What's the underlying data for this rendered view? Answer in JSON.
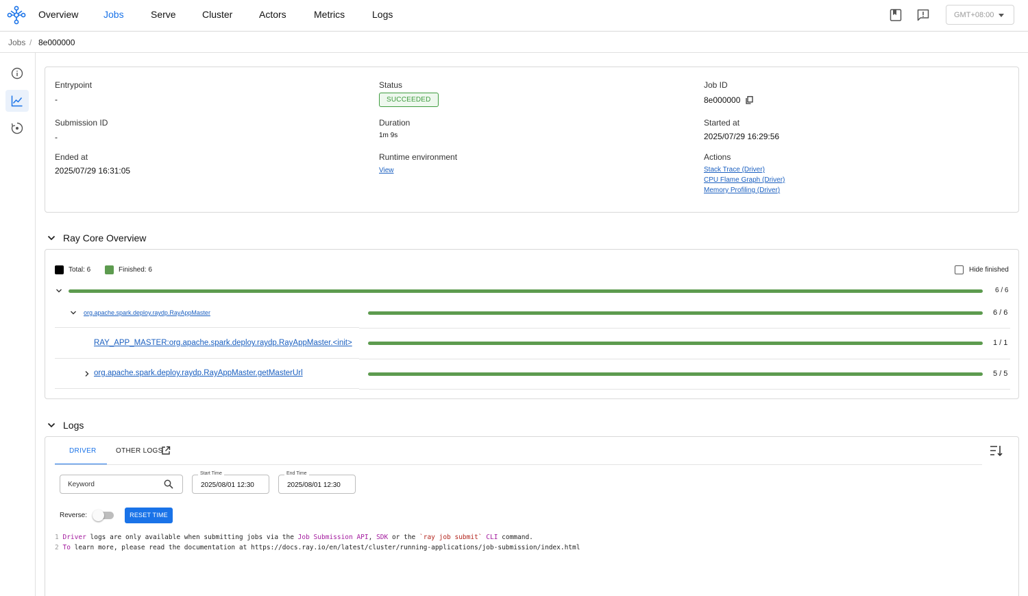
{
  "nav": {
    "items": [
      {
        "label": "Overview",
        "active": false
      },
      {
        "label": "Jobs",
        "active": true
      },
      {
        "label": "Serve",
        "active": false
      },
      {
        "label": "Cluster",
        "active": false
      },
      {
        "label": "Actors",
        "active": false
      },
      {
        "label": "Metrics",
        "active": false
      },
      {
        "label": "Logs",
        "active": false
      }
    ],
    "timezone": "GMT+08:00",
    "accent_color": "#1a73e8"
  },
  "breadcrumb": {
    "parent": "Jobs",
    "separator": "/",
    "current": "8e000000"
  },
  "sidebar": {
    "items": [
      "info-icon",
      "metrics-chart-icon",
      "timeline-icon"
    ]
  },
  "job": {
    "entrypoint_label": "Entrypoint",
    "entrypoint": "-",
    "status_label": "Status",
    "status": "SUCCEEDED",
    "job_id_label": "Job ID",
    "job_id": "8e000000",
    "submission_id_label": "Submission ID",
    "submission_id": "-",
    "duration_label": "Duration",
    "duration": "1m 9s",
    "started_label": "Started at",
    "started": "2025/07/29 16:29:56",
    "ended_label": "Ended at",
    "ended": "2025/07/29 16:31:05",
    "runtime_env_label": "Runtime environment",
    "runtime_env_link": "View",
    "actions_label": "Actions",
    "actions": [
      "Stack Trace (Driver)",
      "CPU Flame Graph (Driver)",
      "Memory Profiling (Driver)"
    ],
    "status_color": "#3e9b3e"
  },
  "ray_core": {
    "title": "Ray Core Overview",
    "legend_total": "Total: 6",
    "legend_finished": "Finished: 6",
    "hide_finished": "Hide finished",
    "progress_color": "#5d9b4f",
    "overall": {
      "count": "6 / 6",
      "fraction": 1.0
    },
    "rows": [
      {
        "label": "org.apache.spark.deploy.raydp.RayAppMaster",
        "count": "6 / 6",
        "fraction": 1.0
      },
      {
        "label": "RAY_APP_MASTER:org.apache.spark.deploy.raydp.RayAppMaster.<init>",
        "count": "1 / 1",
        "fraction": 1.0
      },
      {
        "label": "org.apache.spark.deploy.raydp.RayAppMaster.getMasterUrl",
        "count": "5 / 5",
        "fraction": 1.0
      }
    ]
  },
  "logs": {
    "title": "Logs",
    "tabs": [
      "DRIVER",
      "OTHER LOGS"
    ],
    "keyword_placeholder": "Keyword",
    "start_time_label": "Start Time",
    "start_time": "2025/08/01 12:30",
    "end_time_label": "End Time",
    "end_time": "2025/08/01 12:30",
    "reverse_label": "Reverse:",
    "reverse_on": false,
    "reset_label": "RESET TIME",
    "lines": [
      {
        "n": "1",
        "t1": "Driver",
        "t2": " logs are only available when submitting jobs via the ",
        "t3": "Job Submission API",
        "t4": ", ",
        "t5": "SDK",
        "t6": " or the ",
        "t7": "`ray job submit`",
        "t8": " ",
        "t9": "CLI",
        "t10": " command."
      },
      {
        "n": "2",
        "t1": "To",
        "t2": " learn more, please read the documentation at https://docs.ray.io/en/latest/cluster/running-applications/job-submission/index.html"
      }
    ]
  }
}
